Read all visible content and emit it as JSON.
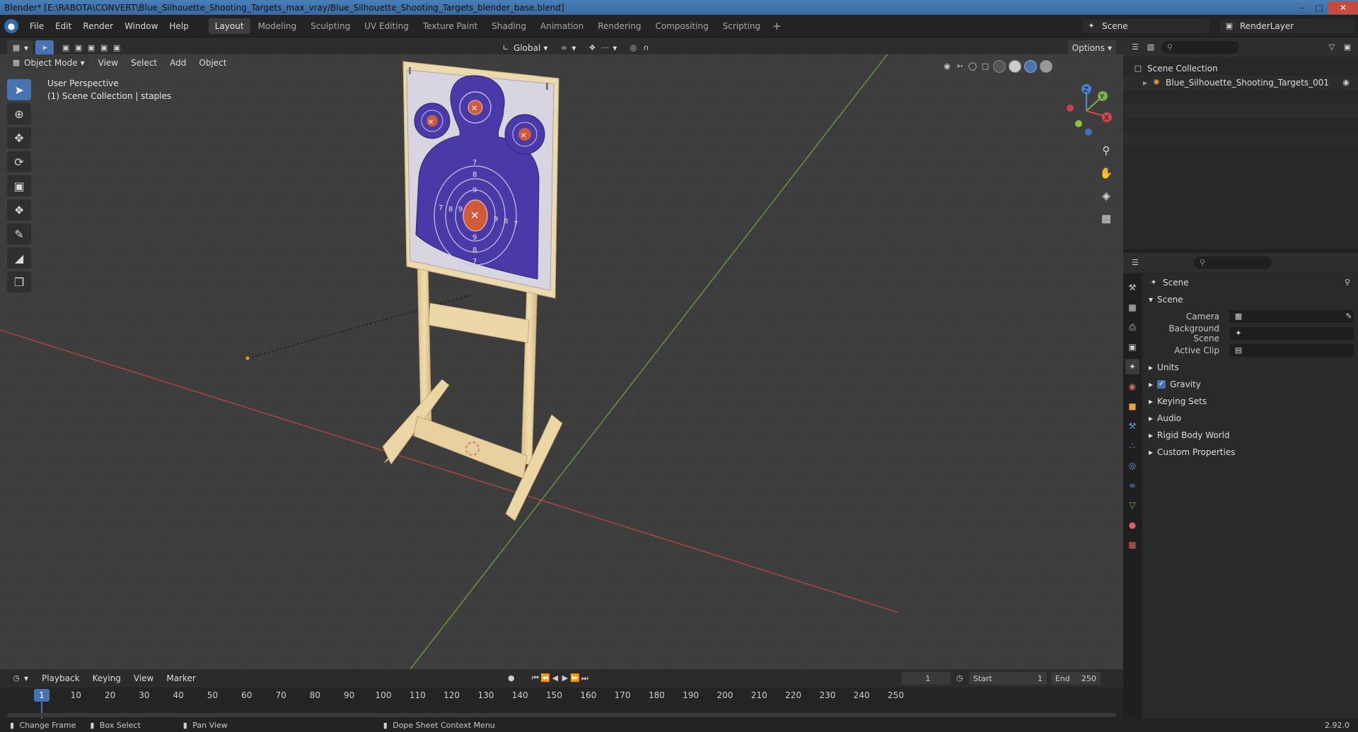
{
  "window": {
    "title": "Blender* [E:\\RABOTA\\CONVERT\\Blue_Silhouette_Shooting_Targets_max_vray/Blue_Silhouette_Shooting_Targets_blender_base.blend]"
  },
  "menus": [
    "File",
    "Edit",
    "Render",
    "Window",
    "Help"
  ],
  "workspaces": [
    "Layout",
    "Modeling",
    "Sculpting",
    "UV Editing",
    "Texture Paint",
    "Shading",
    "Animation",
    "Rendering",
    "Compositing",
    "Scripting"
  ],
  "active_workspace": "Layout",
  "scene_selector": {
    "value": "Scene"
  },
  "render_layer": {
    "value": "RenderLayer"
  },
  "header": {
    "transform_orientation": "Global",
    "options": "Options"
  },
  "viewport_header": {
    "mode": "Object Mode",
    "menus": [
      "View",
      "Select",
      "Add",
      "Object"
    ]
  },
  "viewport_info": {
    "line1": "User Perspective",
    "line2": "(1) Scene Collection | staples"
  },
  "target_numbers": {
    "r7": "7",
    "r8": "8",
    "r9": "9"
  },
  "outliner": {
    "root": "Scene Collection",
    "item": "Blue_Silhouette_Shooting_Targets_001"
  },
  "properties": {
    "context_title": "Scene",
    "section": "Scene",
    "camera_label": "Camera",
    "background_label": "Background Scene",
    "clip_label": "Active Clip",
    "panels": [
      "Units",
      "Gravity",
      "Keying Sets",
      "Audio",
      "Rigid Body World",
      "Custom Properties"
    ]
  },
  "timeline": {
    "menus": [
      "Playback",
      "Keying",
      "View",
      "Marker"
    ],
    "current_frame": "1",
    "start_label": "Start",
    "start": "1",
    "end_label": "End",
    "end": "250",
    "ruler": [
      "1",
      "10",
      "20",
      "30",
      "40",
      "50",
      "60",
      "70",
      "80",
      "90",
      "100",
      "110",
      "120",
      "130",
      "140",
      "150",
      "160",
      "170",
      "180",
      "190",
      "200",
      "210",
      "220",
      "230",
      "240",
      "250"
    ]
  },
  "status_bar": {
    "items": [
      "Change Frame",
      "Box Select",
      "Pan View",
      "Dope Sheet Context Menu"
    ],
    "version": "2.92.0"
  },
  "colors": {
    "accent": "#4772b3",
    "target_blue": "#4a3aa8",
    "target_red": "#d25a3c",
    "wood": "#e6cf9f",
    "x_axis": "#c04545",
    "y_axis": "#6a9a3a"
  }
}
